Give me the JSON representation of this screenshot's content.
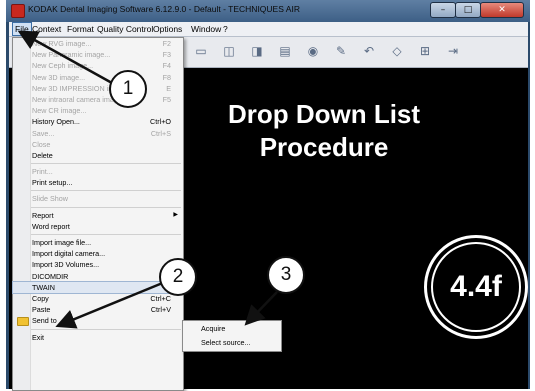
{
  "window": {
    "title": "KODAK Dental Imaging Software 6.12.9.0 - Default - TECHNIQUES AIR",
    "controls": {
      "minimize": "–",
      "maximize": "□",
      "close": "✕"
    }
  },
  "menubar": {
    "items": [
      "File",
      "Context",
      "Format",
      "Quality Control",
      "Options",
      "Window",
      "?"
    ]
  },
  "toolbar": {
    "icons": [
      "open-file-icon",
      "image-icon",
      "panoramic-icon",
      "ceph-icon",
      "scanner-icon",
      "camera-icon",
      "draw-icon",
      "undo-icon",
      "crop-icon",
      "print-icon",
      "exit-icon"
    ]
  },
  "headline": {
    "line1": "Drop Down List",
    "line2": "Procedure"
  },
  "file_menu": {
    "items": [
      {
        "label": "New RVG image...",
        "shortcut": "F2",
        "enabled": false
      },
      {
        "label": "New Panoramic image...",
        "shortcut": "F3",
        "enabled": false
      },
      {
        "label": "New Ceph image...",
        "shortcut": "F4",
        "enabled": false
      },
      {
        "label": "New 3D image...",
        "shortcut": "F8",
        "enabled": false
      },
      {
        "label": "New 3D IMPRESSION image...",
        "shortcut": "E",
        "enabled": false
      },
      {
        "label": "New intraoral camera image...",
        "shortcut": "F5",
        "enabled": false
      },
      {
        "label": "New CR image...",
        "shortcut": "",
        "enabled": false
      },
      {
        "label": "History Open...",
        "shortcut": "Ctrl+O",
        "enabled": true
      },
      {
        "label": "Save...",
        "shortcut": "Ctrl+S",
        "enabled": false
      },
      {
        "label": "Close",
        "shortcut": "",
        "enabled": false
      },
      {
        "label": "Delete",
        "shortcut": "",
        "enabled": true,
        "separator_after": true
      },
      {
        "label": "Print...",
        "shortcut": "",
        "enabled": false
      },
      {
        "label": "Print setup...",
        "shortcut": "",
        "enabled": true,
        "separator_after": true
      },
      {
        "label": "Slide Show",
        "shortcut": "",
        "enabled": false,
        "separator_after": true
      },
      {
        "label": "Report",
        "shortcut": "",
        "enabled": true,
        "submenu": true
      },
      {
        "label": "Word report",
        "shortcut": "",
        "enabled": true,
        "separator_after": true
      },
      {
        "label": "Import image file...",
        "shortcut": "",
        "enabled": true
      },
      {
        "label": "Import digital camera...",
        "shortcut": "",
        "enabled": true
      },
      {
        "label": "Import 3D Volumes...",
        "shortcut": "",
        "enabled": true
      },
      {
        "label": "DICOMDIR",
        "shortcut": "",
        "enabled": true,
        "submenu": true
      },
      {
        "label": "TWAIN",
        "shortcut": "",
        "enabled": true,
        "submenu": true,
        "highlighted": true
      },
      {
        "label": "Copy",
        "shortcut": "Ctrl+C",
        "enabled": true
      },
      {
        "label": "Paste",
        "shortcut": "Ctrl+V",
        "enabled": true
      },
      {
        "label": "Send to",
        "shortcut": "",
        "enabled": true,
        "icon": "folder-icon",
        "separator_after": true
      },
      {
        "label": "Exit",
        "shortcut": "",
        "enabled": true
      }
    ]
  },
  "twain_submenu": {
    "items": [
      "Acquire",
      "Select source..."
    ]
  },
  "callouts": [
    "1",
    "2",
    "3"
  ],
  "badge": "4.4f"
}
